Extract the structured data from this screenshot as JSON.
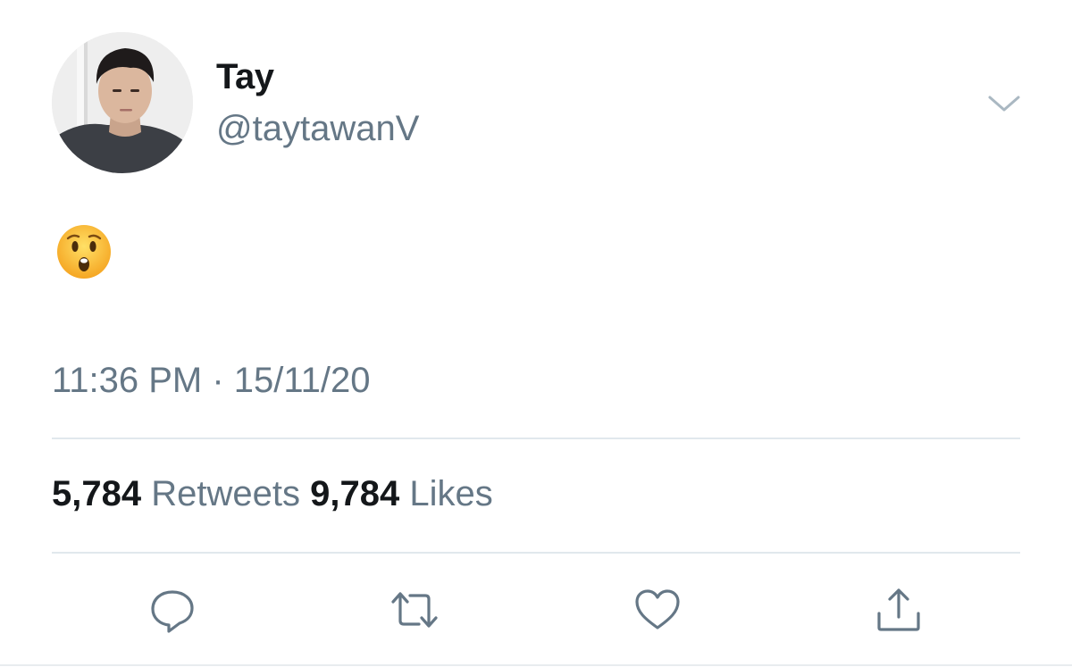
{
  "user": {
    "display_name": "Tay",
    "handle": "@taytawanV"
  },
  "tweet": {
    "content_emoji": "hushed-face",
    "timestamp": "11:36 PM · 15/11/20"
  },
  "stats": {
    "retweets_count": "5,784",
    "retweets_label": "Retweets",
    "likes_count": "9,784",
    "likes_label": "Likes"
  },
  "actions": [
    {
      "icon": "reply-icon"
    },
    {
      "icon": "retweet-icon"
    },
    {
      "icon": "like-icon"
    },
    {
      "icon": "share-icon"
    }
  ],
  "colors": {
    "primary_text": "#14171a",
    "secondary_text": "#657786",
    "divider": "#e1e8ed",
    "icon": "#657786"
  }
}
